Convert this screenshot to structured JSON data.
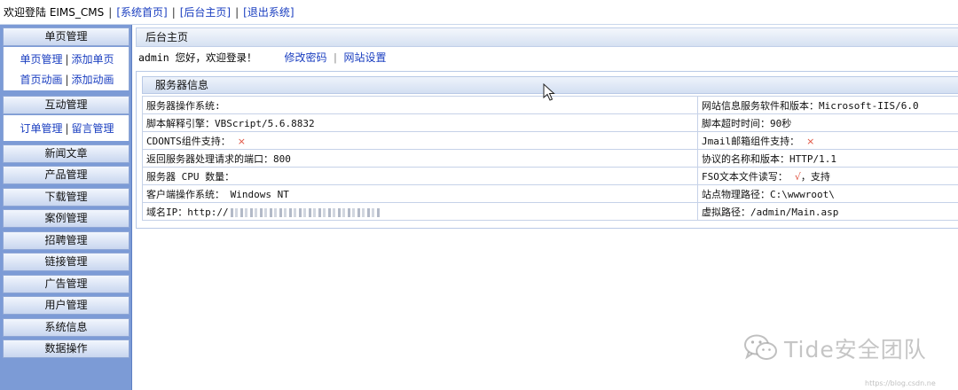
{
  "topbar": {
    "welcome": "欢迎登陆 EIMS_CMS",
    "sep": "|",
    "links": [
      "[系统首页]",
      "[后台主页]",
      "[退出系统]"
    ]
  },
  "sidebar": {
    "groups": [
      {
        "title": "单页管理",
        "rows": [
          [
            "单页管理",
            "添加单页"
          ],
          [
            "首页动画",
            "添加动画"
          ]
        ]
      },
      {
        "title": "互动管理",
        "rows": [
          [
            "订单管理",
            "留言管理"
          ]
        ]
      },
      {
        "title": "新闻文章"
      },
      {
        "title": "产品管理"
      },
      {
        "title": "下载管理"
      },
      {
        "title": "案例管理"
      },
      {
        "title": "招聘管理"
      },
      {
        "title": "链接管理"
      },
      {
        "title": "广告管理"
      },
      {
        "title": "用户管理"
      },
      {
        "title": "系统信息"
      },
      {
        "title": "数据操作"
      }
    ],
    "bar": "|"
  },
  "main": {
    "crumb": "后台主页",
    "welcome_text": "admin 您好，欢迎登录！",
    "change_password": "修改密码",
    "welcome_bar": "|",
    "site_settings": "网站设置",
    "panel_title": "服务器信息",
    "rows": [
      [
        "服务器操作系统:",
        "网站信息服务软件和版本：Microsoft-IIS/6.0"
      ],
      [
        "脚本解释引擎：VBScript/5.6.8832",
        "脚本超时时间：90秒"
      ],
      [
        "CDONTS组件支持：",
        "Jmail邮箱组件支持："
      ],
      [
        "返回服务器处理请求的端口：800",
        "协议的名称和版本：HTTP/1.1"
      ],
      [
        "服务器 CPU 数量：",
        "FSO文本文件读写："
      ],
      [
        "客户端操作系统： Windows NT",
        "站点物理路径：C:\\wwwroot\\"
      ],
      [
        "域名IP：http://",
        "虚拟路径：/admin/Main.asp"
      ]
    ],
    "x_mark": "×",
    "check_mark": "√",
    "fso_suffix": "，支持"
  },
  "watermark": {
    "text": "Tide安全团队",
    "url": "https://blog.csdn.ne"
  },
  "colors": {
    "sidebar_bg": "#7c9bd6",
    "link": "#1a3ec0",
    "mark": "#e0523f"
  },
  "icons": [
    "mouse-cursor-icon",
    "wechat-icon",
    "cross-icon",
    "check-icon"
  ]
}
